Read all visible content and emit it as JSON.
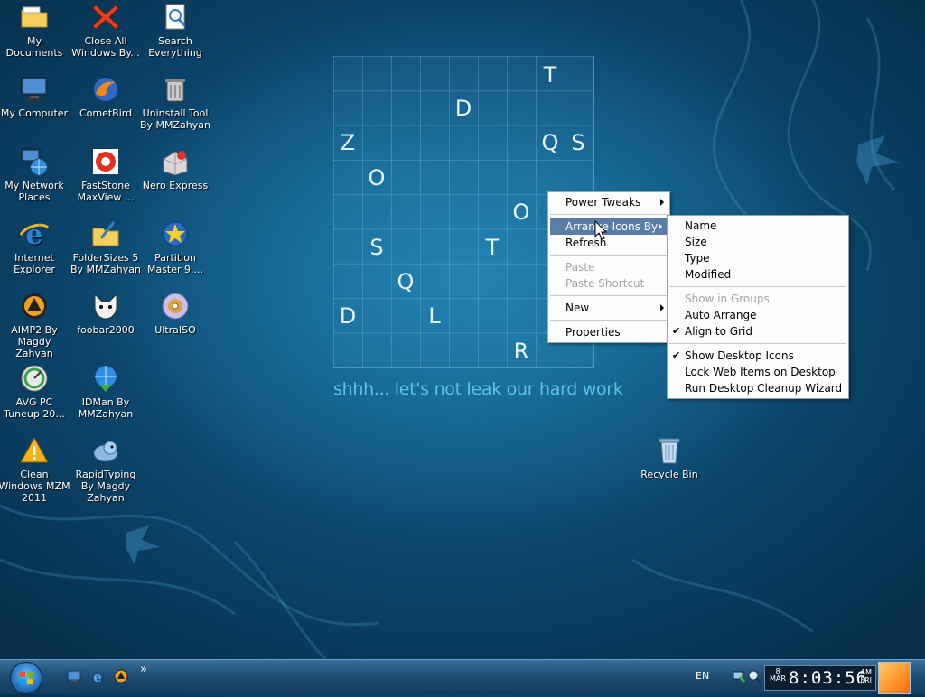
{
  "desktop_icons": [
    {
      "label": "My Documents",
      "icon": "folder-icon"
    },
    {
      "label": "Close All Windows By...",
      "icon": "red-x-icon"
    },
    {
      "label": "Search Everything",
      "icon": "search-icon"
    },
    {
      "label": "My Computer",
      "icon": "computer-icon"
    },
    {
      "label": "CometBird",
      "icon": "cometbird-icon"
    },
    {
      "label": "Uninstall Tool By MMZahyan",
      "icon": "trash-tool-icon"
    },
    {
      "label": "My Network Places",
      "icon": "network-icon"
    },
    {
      "label": "FastStone MaxView ...",
      "icon": "faststone-icon"
    },
    {
      "label": "Nero Express",
      "icon": "nero-icon"
    },
    {
      "label": "Internet Explorer",
      "icon": "ie-icon"
    },
    {
      "label": "FolderSizes 5 By MMZahyan",
      "icon": "foldersizes-icon"
    },
    {
      "label": "Partition Master 9....",
      "icon": "partition-icon"
    },
    {
      "label": "AIMP2 By Magdy Zahyan",
      "icon": "aimp-icon"
    },
    {
      "label": "foobar2000",
      "icon": "foobar-icon"
    },
    {
      "label": "UltraISO",
      "icon": "disc-icon"
    },
    {
      "label": "AVG PC Tuneup 20...",
      "icon": "avg-icon"
    },
    {
      "label": "IDMan By MMZahyan",
      "icon": "idm-icon"
    },
    {
      "label": "Clean Windows MZM 2011",
      "icon": "warning-icon"
    },
    {
      "label": "RapidTyping By Magdy Zahyan",
      "icon": "rapidtyping-icon"
    },
    {
      "label": "Recycle Bin",
      "icon": "recycle-bin-icon"
    }
  ],
  "wallpaper": {
    "letters": [
      "T",
      "D",
      "Z",
      "Q",
      "S",
      "O",
      "O",
      "S",
      "T",
      "Q",
      "D",
      "L",
      "R"
    ],
    "tagline": "shhh... let's not leak our hard work"
  },
  "context_menu": {
    "items": [
      {
        "label": "Power Tweaks"
      },
      {
        "label": "Arrange Icons By"
      },
      {
        "label": "Refresh"
      },
      {
        "label": "Paste"
      },
      {
        "label": "Paste Shortcut"
      },
      {
        "label": "New"
      },
      {
        "label": "Properties"
      }
    ]
  },
  "submenu": {
    "items": [
      {
        "label": "Name"
      },
      {
        "label": "Size"
      },
      {
        "label": "Type"
      },
      {
        "label": "Modified"
      },
      {
        "label": "Show in Groups"
      },
      {
        "label": "Auto Arrange"
      },
      {
        "label": "Align to Grid"
      },
      {
        "label": "Show Desktop Icons"
      },
      {
        "label": "Lock Web Items on Desktop"
      },
      {
        "label": "Run Desktop Cleanup Wizard"
      }
    ],
    "checkmark": "✔"
  },
  "taskbar": {
    "quicklaunch_more": "»",
    "language": "EN",
    "clock": {
      "day_num": "8",
      "month": "MAR",
      "time": "8:03:56",
      "ampm": "AM",
      "weekday": "FRI"
    }
  }
}
